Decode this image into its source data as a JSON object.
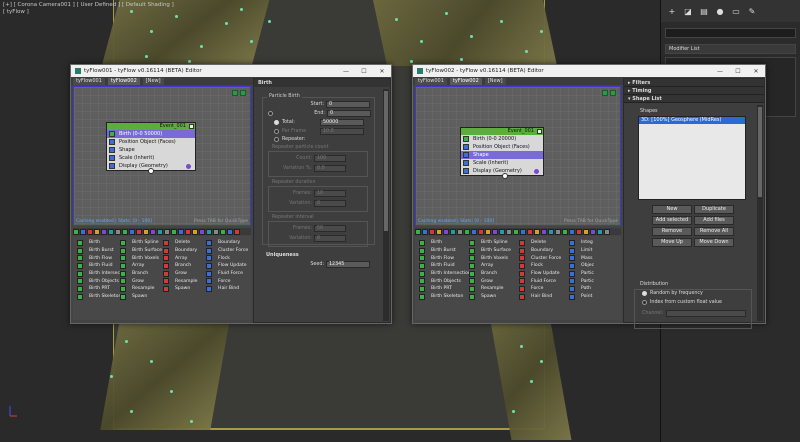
{
  "viewport": {
    "label_line1": "[+] [ Corona Camera001 ] [ User Defined ] [ Default Shading ]",
    "label_line2": "[ tyFlow ]"
  },
  "cmd_panel": {
    "modifier_list": "Modifier List"
  },
  "win1": {
    "title": "tyFlow001 - tyFlow v0.16114 (BETA) Editor",
    "tabs": [
      "tyFlow001",
      "tyFlow002",
      "[New]"
    ],
    "event_name": "Event_001",
    "operators": [
      "Birth (0-0 50000)",
      "Position Object (Faces)",
      "Shape",
      "Scale (Inherit)",
      "Display (Geometry)"
    ],
    "status_left": "Caching enabled | Stats: [0 - 100]",
    "status_right": "Press TAB for QuickType",
    "palette": [
      "Birth",
      "Birth Spline",
      "Delete",
      "Boundary",
      "Birth Burst",
      "Birth Surface",
      "Boundary",
      "Cluster Force",
      "Birth Flow",
      "Birth Voxels",
      "Array",
      "Flock",
      "Birth Fluid",
      "Array",
      "Branch",
      "Flow Update",
      "Birth Intersections",
      "Branch",
      "Grow",
      "Fluid Force",
      "Birth Objects",
      "Grow",
      "Resample",
      "Force",
      "Birth PRT",
      "Resample",
      "Spawn",
      "Hair Bind",
      "Birth Skeleton",
      "Spawn",
      "",
      ""
    ]
  },
  "birth_panel": {
    "rollout": "Birth",
    "group_particle_birth": "Particle Birth",
    "start_label": "Start:",
    "start_val": "0",
    "end_label": "End:",
    "end_val": "0",
    "total_label": "Total:",
    "total_val": "50000",
    "perframe_label": "Per Frame",
    "perframe_val": "10.0",
    "repeater_label": "Repeater:",
    "group_repeater_count": "Repeater particle count",
    "count_label": "Count:",
    "count_val": "100",
    "variation_pct_label": "Variation %:",
    "variation_pct_val": "0.0",
    "group_repeater_duration": "Repeater duration",
    "frames_label": "Frames:",
    "frames_val": "10",
    "variation_label": "Variation:",
    "variation_val": "0",
    "group_repeater_interval": "Repeater interval",
    "interval_frames_val": "50",
    "interval_variation_val": "0",
    "uniqueness_rollout": "Uniqueness",
    "seed_label": "Seed:",
    "seed_val": "12345"
  },
  "win2": {
    "title": "tyFlow002 - tyFlow v0.16114 (BETA) Editor",
    "tabs": [
      "tyFlow001",
      "tyFlow002",
      "[New]"
    ],
    "event_name": "Event_001",
    "operators": [
      "Birth (0-0 20000)",
      "Position Object (Faces)",
      "Shape",
      "Scale (Inherit)",
      "Display (Geometry)"
    ],
    "status_left": "Caching enabled | Stats: [0 - 100]",
    "status_right": "Press TAB for QuickType",
    "palette": [
      "Birth",
      "Birth Spline",
      "Delete",
      "Integ",
      "Birth Burst",
      "Birth Surface",
      "Boundary",
      "Limit",
      "Birth Flow",
      "Birth Voxels",
      "Cluster Force",
      "Mass",
      "Birth Fluid",
      "Array",
      "Flock",
      "Objec",
      "Birth Intersections",
      "Branch",
      "Flow Update",
      "Partic",
      "Birth Objects",
      "Grow",
      "Fluid Force",
      "Partic",
      "Birth PRT",
      "Resample",
      "Force",
      "Path",
      "Birth Skeleton",
      "Spawn",
      "Hair Bind",
      "Point"
    ]
  },
  "shape_panel": {
    "rollouts": [
      "Filters",
      "Timing",
      "Shape List"
    ],
    "shapes_label": "Shapes",
    "shapes_item": "3D: [100%] Geosphere (MidRes)",
    "buttons": [
      "New",
      "Duplicate",
      "Add selected",
      "Add files",
      "Remove",
      "Remove All",
      "Move Up",
      "Move Down"
    ],
    "distribution_label": "Distribution",
    "dist_opt1": "Random by frequency",
    "dist_opt2": "Index from custom float value",
    "channel_label": "Channel:"
  }
}
